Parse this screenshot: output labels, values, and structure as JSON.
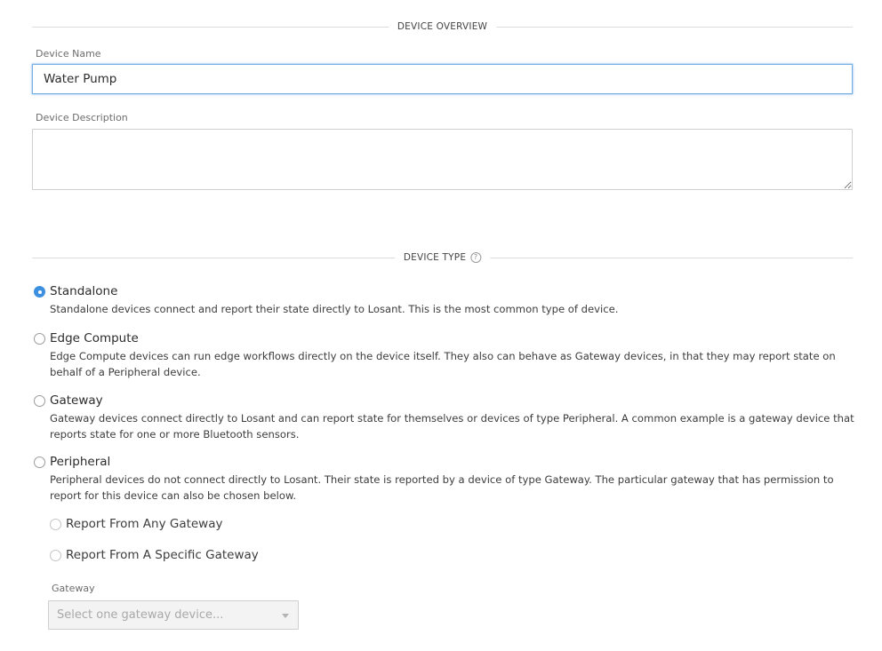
{
  "overview": {
    "header": "DEVICE OVERVIEW",
    "name_label": "Device Name",
    "name_value": "Water Pump",
    "description_label": "Device Description",
    "description_value": ""
  },
  "device_type": {
    "header": "DEVICE TYPE",
    "help_icon": "?",
    "options": [
      {
        "title": "Standalone",
        "description": "Standalone devices connect and report their state directly to Losant. This is the most common type of device.",
        "selected": true
      },
      {
        "title": "Edge Compute",
        "description": "Edge Compute devices can run edge workflows directly on the device itself. They also can behave as Gateway devices, in that they may report state on behalf of a Peripheral device.",
        "selected": false
      },
      {
        "title": "Gateway",
        "description": "Gateway devices connect directly to Losant and can report state for themselves or devices of type Peripheral. A common example is a gateway device that reports state for one or more Bluetooth sensors.",
        "selected": false
      },
      {
        "title": "Peripheral",
        "description": "Peripheral devices do not connect directly to Losant. Their state is reported by a device of type Gateway. The particular gateway that has permission to report for this device can also be chosen below.",
        "selected": false
      }
    ],
    "peripheral_options": [
      {
        "title": "Report From Any Gateway",
        "selected": false
      },
      {
        "title": "Report From A Specific Gateway",
        "selected": false
      }
    ],
    "gateway_label": "Gateway",
    "gateway_placeholder": "Select one gateway device..."
  },
  "colors": {
    "accent": "#3d8fe0",
    "focus_border": "#76aee6",
    "divider": "#dcdcdc"
  }
}
